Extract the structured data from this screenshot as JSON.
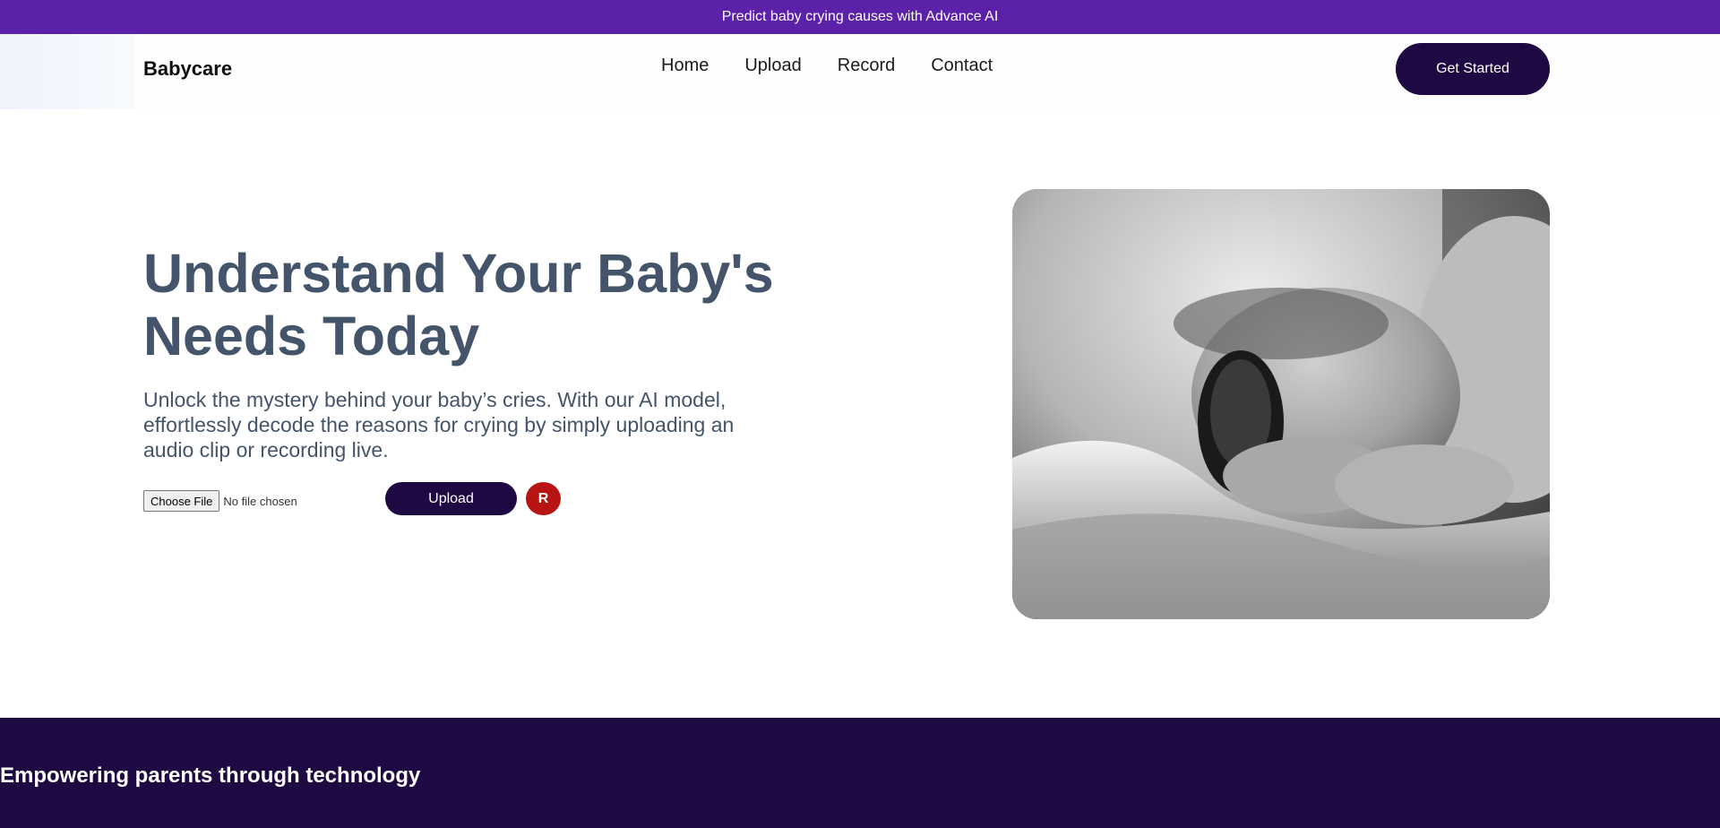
{
  "top_banner": {
    "text": "Predict baby crying causes with Advance AI"
  },
  "navbar": {
    "logo": "Babycare",
    "links": [
      "Home",
      "Upload",
      "Record",
      "Contact"
    ],
    "cta": "Get Started"
  },
  "hero": {
    "title_line1": "Understand Your Baby's",
    "title_line2": "Needs Today",
    "description": "Unlock the mystery behind your baby’s cries. With our AI model, effortlessly decode the reasons for crying by simply uploading an audio clip or recording live.",
    "file_input": {
      "button_label": "Choose File",
      "status": "No file chosen"
    },
    "upload_label": "Upload",
    "record_label": "R"
  },
  "footer": {
    "title": "Empowering parents through technology"
  },
  "colors": {
    "banner": "#5b21a8",
    "primary_dark": "#1f0942",
    "heading": "#44546a",
    "record_red": "#b91414"
  }
}
